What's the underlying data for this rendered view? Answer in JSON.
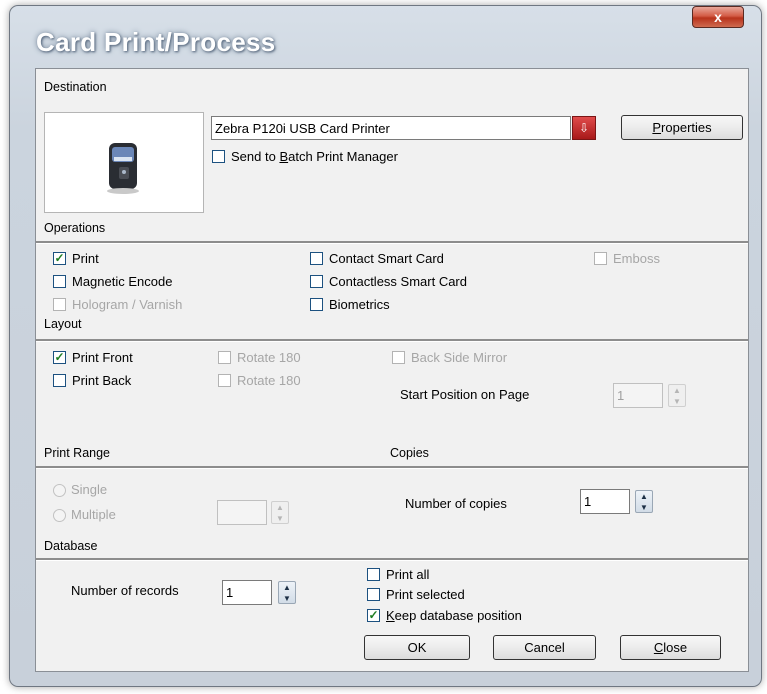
{
  "window": {
    "title": "Card Print/Process",
    "close_glyph": "x"
  },
  "destination": {
    "label": "Destination",
    "printer": "Zebra P120i USB Card Printer",
    "properties_prefix": "P",
    "properties_rest": "roperties",
    "batch_pre": "Send to ",
    "batch_u": "B",
    "batch_post": "atch Print Manager",
    "batch_checked": false
  },
  "operations": {
    "label": "Operations",
    "print": "Print",
    "magnetic": "Magnetic Encode",
    "hologram": "Hologram / Varnish",
    "contact": "Contact Smart Card",
    "contactless": "Contactless Smart Card",
    "biometrics": "Biometrics",
    "emboss": "Emboss"
  },
  "layout": {
    "label": "Layout",
    "print_front": "Print Front",
    "print_back": "Print Back",
    "rotate_front": "Rotate 180",
    "rotate_back": "Rotate 180",
    "back_mirror": "Back Side Mirror",
    "start_position_label": "Start Position on Page",
    "start_position_value": "1"
  },
  "print_range": {
    "label": "Print Range",
    "single": "Single",
    "multiple": "Multiple",
    "multiple_value": ""
  },
  "copies": {
    "label": "Copies",
    "count_label": "Number of copies",
    "count_value": "1"
  },
  "database": {
    "label": "Database",
    "records_label": "Number of records",
    "records_value": "1",
    "print_all": "Print all",
    "print_selected": "Print selected",
    "keep_u": "K",
    "keep_rest": "eep database position"
  },
  "buttons": {
    "ok": "OK",
    "cancel": "Cancel",
    "close_u": "C",
    "close_rest": "lose"
  },
  "colors": {
    "check": "#1f7d22",
    "dropdown": "#c0282a"
  }
}
